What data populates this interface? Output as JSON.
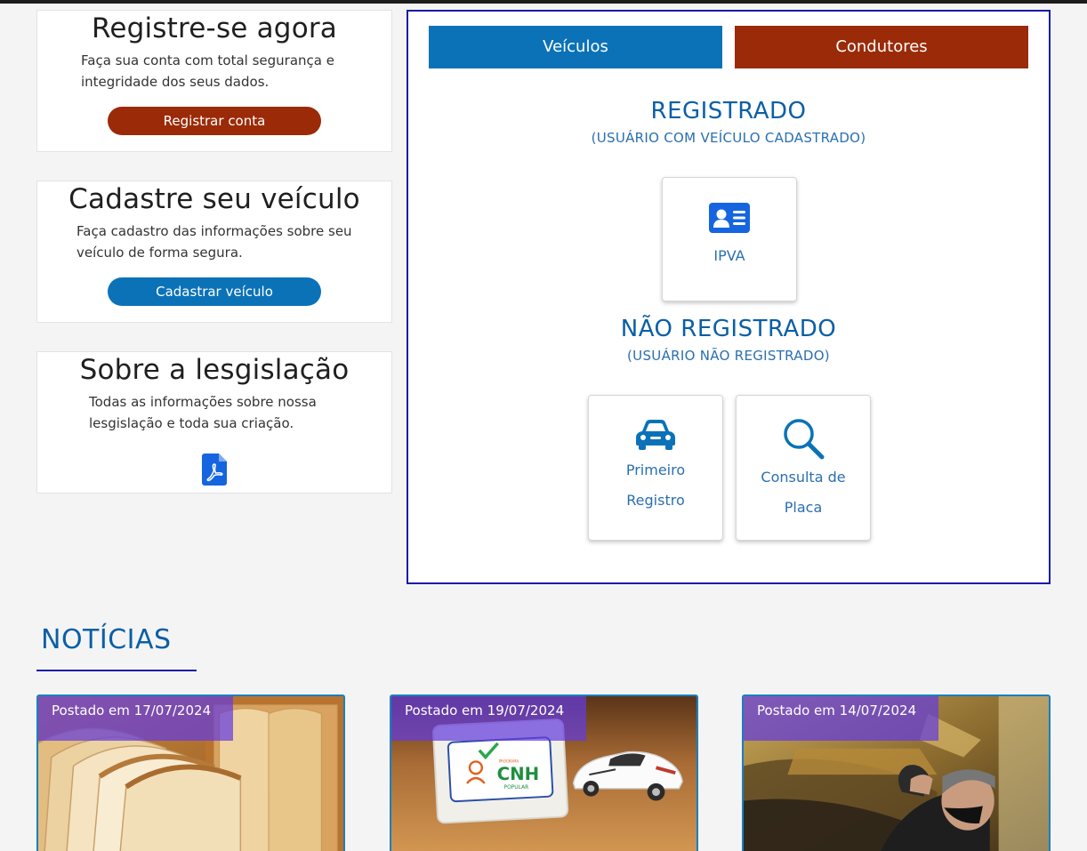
{
  "cards": {
    "register": {
      "title": "Registre-se agora",
      "text": "Faça sua conta com total segurança e integridade dos seus dados.",
      "button": "Registrar conta"
    },
    "vehicle": {
      "title": "Cadastre seu veículo",
      "text": "Faça cadastro das informações sobre seu veículo de forma segura.",
      "button": "Cadastrar veículo"
    },
    "legislation": {
      "title": "Sobre a lesgislação",
      "text": "Todas as informações sobre nossa lesgislação e toda sua criação.",
      "icon": "pdf-file-icon"
    }
  },
  "panel": {
    "tabs": [
      "Veículos",
      "Condutores"
    ],
    "registered": {
      "title": "REGISTRADO",
      "subtitle": "(USUÁRIO COM VEÍCULO CADASTRADO)",
      "services": [
        {
          "label": "IPVA",
          "icon": "id-card-icon"
        }
      ]
    },
    "unregistered": {
      "title": "NÃO REGISTRADO",
      "subtitle": "(USUÁRIO NÃO REGISTRADO)",
      "services": [
        {
          "label_line1": "Primeiro",
          "label_line2": "Registro",
          "icon": "car-icon"
        },
        {
          "label_line1": "Consulta de",
          "label_line2": "Placa",
          "icon": "search-icon"
        }
      ]
    }
  },
  "news": {
    "title": "NOTÍCIAS",
    "items": [
      {
        "date": "Postado em 17/07/2024",
        "image": "bread-photo"
      },
      {
        "date": "Postado em 19/07/2024",
        "image": "cnh-popular-toy-car-photo",
        "image_text": "CNH",
        "image_subtext": "POPULAR",
        "image_small": "PROGRAMA"
      },
      {
        "date": "Postado em 14/07/2024",
        "image": "mechanic-under-car-photo"
      }
    ]
  },
  "colors": {
    "brand_blue": "#0b72b8",
    "brand_red": "#9b2a08",
    "heading_blue": "#0b5fa5",
    "panel_border": "#1b1ba8",
    "icon_blue": "#1565e0"
  }
}
